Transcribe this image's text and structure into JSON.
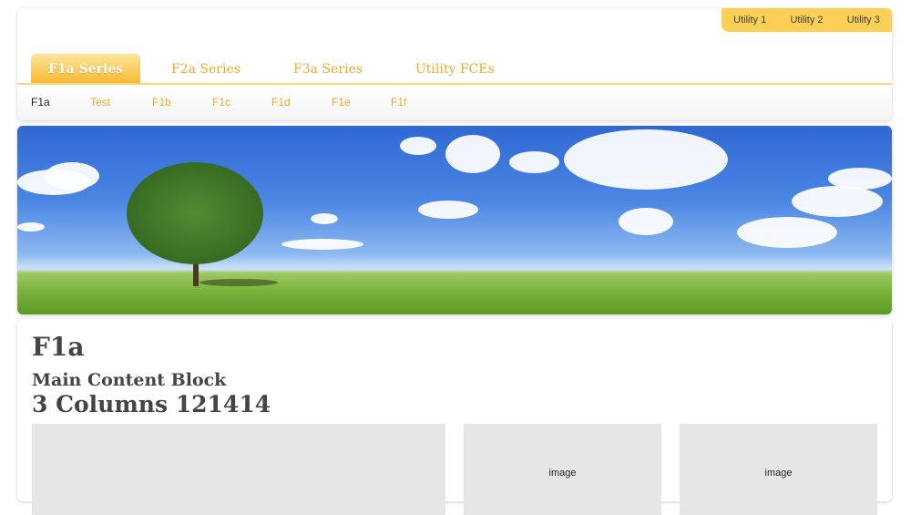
{
  "utility_nav": {
    "items": [
      "Utility 1",
      "Utility 2",
      "Utility 3"
    ]
  },
  "main_tabs": [
    "F1a Series",
    "F2a Series",
    "F3a Series",
    "Utility FCEs"
  ],
  "active_tab": "F1a Series",
  "sub_nav": [
    "F1a",
    "Test",
    "F1b",
    "F1c",
    "F1d",
    "F1e",
    "F1f"
  ],
  "active_sub": "F1a",
  "content": {
    "title": "F1a",
    "subtitle": "Main Content Block",
    "columns_heading": "3 Columns 121414",
    "image_labels": [
      "image",
      "image"
    ]
  },
  "colors": {
    "accent": "#f0a92c",
    "utility_bg": "#fdd055",
    "placeholder_bg": "#e6e6e6",
    "heading": "#444444"
  },
  "icons": {
    "hero": "landscape-tree-image"
  }
}
